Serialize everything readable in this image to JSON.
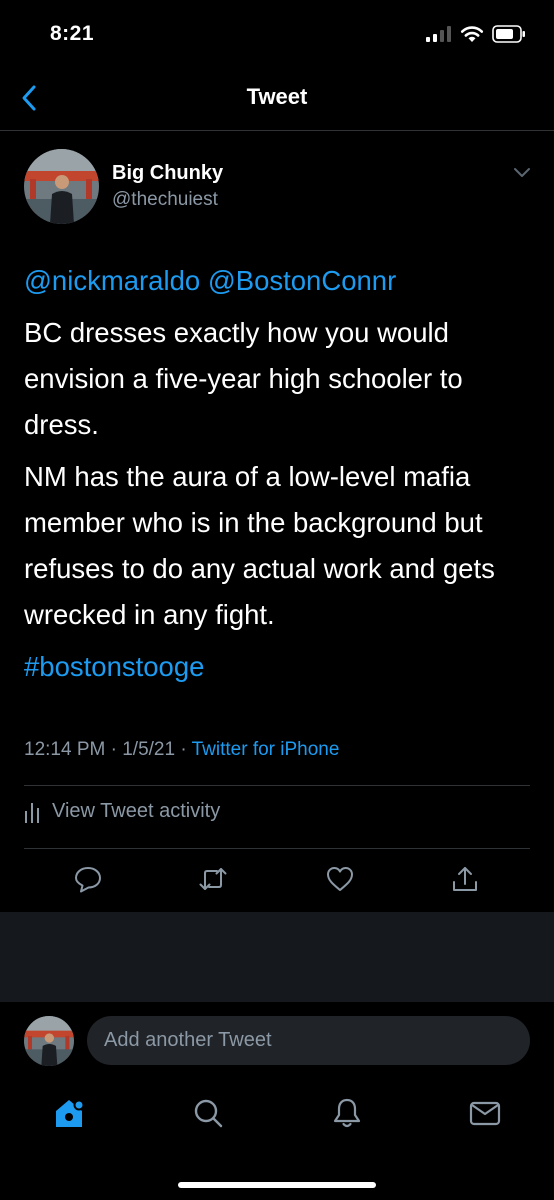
{
  "status_bar": {
    "time": "8:21"
  },
  "nav": {
    "title": "Tweet"
  },
  "tweet": {
    "author_name": "Big Chunky",
    "author_handle": "@thechuiest",
    "mention_1": "@nickmaraldo",
    "mention_2": "@BostonConnr",
    "paragraph_1": "BC dresses exactly how you would envision a five-year high schooler to dress.",
    "paragraph_2": "NM has the aura of a low-level mafia member who is in the background but refuses to do any actual work and gets wrecked in any fight.",
    "hashtag": "#bostonstooge",
    "time": "12:14 PM",
    "date": "1/5/21",
    "source": "Twitter for iPhone",
    "activity_label": "View Tweet activity"
  },
  "compose": {
    "placeholder": "Add another Tweet"
  },
  "colors": {
    "accent": "#1d9bf0",
    "secondary_text": "#8b98a5",
    "background": "#000000",
    "divider": "#2f3336"
  },
  "icons": {
    "status": [
      "signal-icon",
      "wifi-icon",
      "battery-icon"
    ],
    "actions": [
      "reply-icon",
      "retweet-icon",
      "like-icon",
      "share-icon"
    ],
    "tabs": [
      "home-icon",
      "search-icon",
      "notifications-icon",
      "messages-icon"
    ]
  }
}
